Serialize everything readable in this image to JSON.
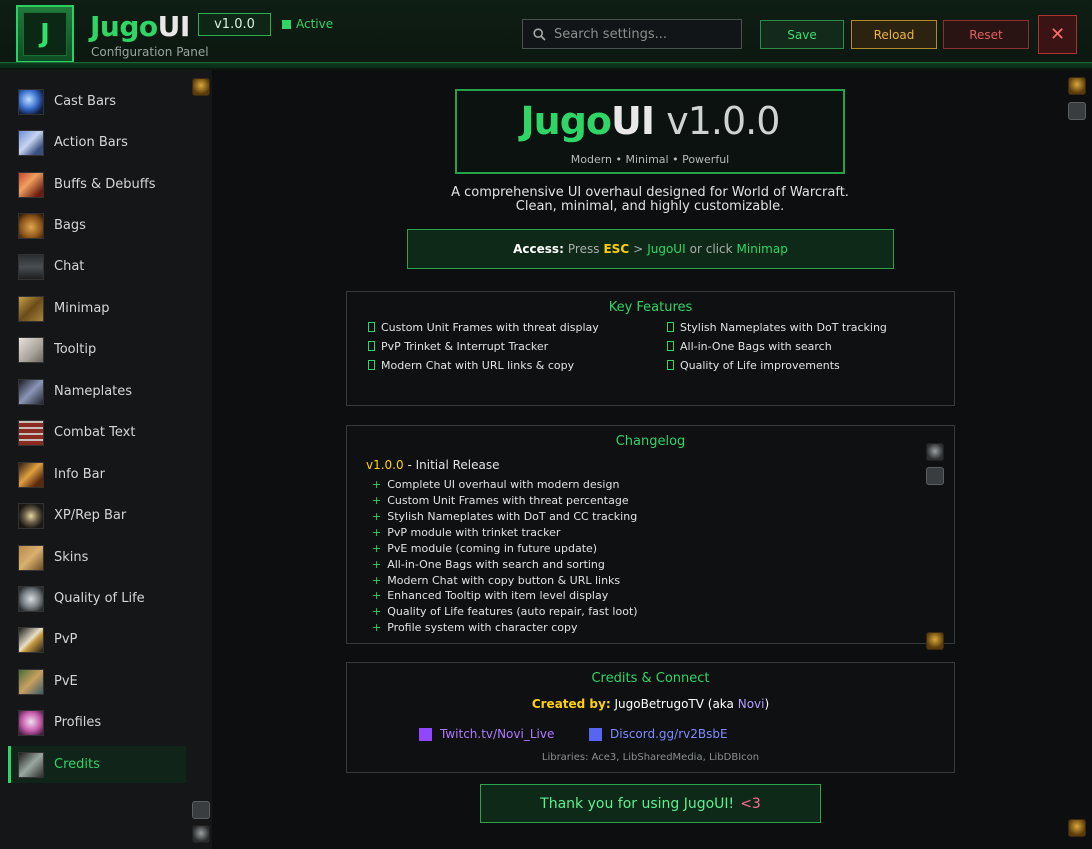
{
  "header": {
    "logo_letter": "J",
    "title_part1": "Jugo",
    "title_part2": "UI",
    "subtitle": "Configuration Panel",
    "version": "v1.0.0",
    "status": "Active",
    "search_placeholder": "Search settings...",
    "save_label": "Save",
    "reload_label": "Reload",
    "reset_label": "Reset",
    "close_glyph": "✕"
  },
  "sidebar": {
    "items": [
      {
        "label": "Cast Bars",
        "icon": "cast-bars-icon"
      },
      {
        "label": "Action Bars",
        "icon": "action-bars-icon"
      },
      {
        "label": "Buffs & Debuffs",
        "icon": "buffs-icon"
      },
      {
        "label": "Bags",
        "icon": "bags-icon"
      },
      {
        "label": "Chat",
        "icon": "chat-icon"
      },
      {
        "label": "Minimap",
        "icon": "minimap-icon"
      },
      {
        "label": "Tooltip",
        "icon": "tooltip-icon"
      },
      {
        "label": "Nameplates",
        "icon": "nameplates-icon"
      },
      {
        "label": "Combat Text",
        "icon": "combat-text-icon"
      },
      {
        "label": "Info Bar",
        "icon": "info-bar-icon"
      },
      {
        "label": "XP/Rep Bar",
        "icon": "xp-rep-icon"
      },
      {
        "label": "Skins",
        "icon": "skins-icon"
      },
      {
        "label": "Quality of Life",
        "icon": "quality-of-life-icon"
      },
      {
        "label": "PvP",
        "icon": "pvp-icon"
      },
      {
        "label": "PvE",
        "icon": "pve-icon"
      },
      {
        "label": "Profiles",
        "icon": "profiles-icon"
      },
      {
        "label": "Credits",
        "icon": "credits-icon"
      }
    ],
    "active_index": 16
  },
  "hero": {
    "title_part1": "Jugo",
    "title_part2": "UI",
    "title_version": "v1.0.0",
    "tagline": "Modern • Minimal • Powerful"
  },
  "description": {
    "line1": "A comprehensive UI overhaul designed for World of Warcraft.",
    "line2": "Clean, minimal, and highly customizable."
  },
  "access": {
    "label": "Access:",
    "press": "Press",
    "key": "ESC",
    "arrow": ">",
    "addon": "JugoUI",
    "or_click": "or click",
    "minimap": "Minimap"
  },
  "features": {
    "title": "Key Features",
    "left": [
      "Custom Unit Frames with threat display",
      "PvP Trinket & Interrupt Tracker",
      "Modern Chat with URL links & copy"
    ],
    "right": [
      "Stylish Nameplates with DoT tracking",
      "All-in-One Bags with search",
      "Quality of Life improvements"
    ]
  },
  "changelog": {
    "title": "Changelog",
    "version": "v1.0.0",
    "release_label": " - Initial Release",
    "items": [
      "Complete UI overhaul with modern design",
      "Custom Unit Frames with threat percentage",
      "Stylish Nameplates with DoT and CC tracking",
      "PvP module with trinket tracker",
      "PvE module (coming in future update)",
      "All-in-One Bags with search and sorting",
      "Modern Chat with copy button & URL links",
      "Enhanced Tooltip with item level display",
      "Quality of Life features (auto repair, fast loot)",
      "Profile system with character copy"
    ]
  },
  "credits": {
    "title": "Credits & Connect",
    "created_label": "Created by:",
    "author": "JugoBetrugoTV (aka",
    "alias": "Novi",
    "close_paren": ")",
    "twitch": "Twitch.tv/Novi_Live",
    "discord": "Discord.gg/rv2BsbE",
    "libraries": "Libraries: Ace3, LibSharedMedia, LibDBIcon"
  },
  "thanks": {
    "text": "Thank you for using JugoUI!",
    "heart": "<3"
  },
  "colors": {
    "accent_green": "#2fd565",
    "gold": "#ffd100",
    "twitch": "#9146ff",
    "discord": "#5865f2",
    "danger": "#e06060"
  }
}
